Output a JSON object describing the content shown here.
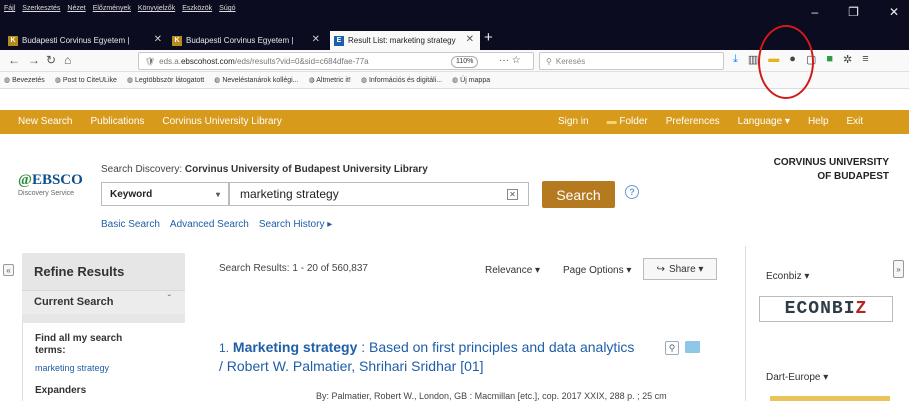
{
  "menubar": {
    "items": [
      "Fájl",
      "Szerkesztés",
      "Nézet",
      "Előzmények",
      "Könyvjelzők",
      "Eszközök",
      "Súgó"
    ]
  },
  "tabs": [
    {
      "title": "Budapesti Corvinus Egyetem |",
      "active": false
    },
    {
      "title": "Budapesti Corvinus Egyetem |",
      "active": false
    },
    {
      "title": "Result List: marketing strategy",
      "active": true
    }
  ],
  "urlbar": {
    "prefix": "eds.a.",
    "domain": "ebscohost.com",
    "path": "/eds/results?vid=0&sid=c684dfae-77a",
    "zoom": "110%",
    "search_placeholder": "Keresés"
  },
  "bookmarks": [
    "Bevezetés",
    "Post to CiteULike",
    "Legtöbbször látogatott",
    "Neveléstanárok kollégi...",
    "Altmetric it!",
    "Információs és digitáli...",
    "Új mappa"
  ],
  "ebsco_toolbar": {
    "left": [
      "New Search",
      "Publications",
      "Corvinus University Library"
    ],
    "right": [
      "Sign in",
      "Folder",
      "Preferences",
      "Language ▾",
      "Help",
      "Exit"
    ]
  },
  "logo": {
    "brand": "EBSCO",
    "sub": "Discovery Service"
  },
  "search": {
    "discovery_prefix": "Search Discovery:",
    "discovery_name": "Corvinus University of Budapest University Library",
    "field": "Keyword",
    "query": "marketing strategy",
    "button": "Search",
    "links": [
      "Basic Search",
      "Advanced Search",
      "Search History ▸"
    ]
  },
  "university": {
    "line1": "CORVINUS UNIVERSITY",
    "line2": "OF BUDAPEST"
  },
  "left_panel": {
    "refine_title": "Refine Results",
    "current_search": "Current Search",
    "find_all": "Find all my search terms:",
    "term": "marketing strategy",
    "expanders": "Expanders"
  },
  "results": {
    "count_text": "Search Results: 1 - 20 of 560,837",
    "relevance": "Relevance ▾",
    "page_options": "Page Options ▾",
    "share": "Share ▾",
    "items": [
      {
        "num": "1.",
        "title_bold": "Marketing strategy",
        "title_rest": ": Based on first principles and data analytics / Robert W. Palmatier, Shrihari Sridhar [01]",
        "byline": "By: Palmatier, Robert W., London, GB : Macmillan [etc.], cop. 2017 XXIX, 288 p. ; 25 cm"
      }
    ]
  },
  "right_panel": {
    "econbiz_label": "Econbiz ▾",
    "econbiz_logo_a": "ECON",
    "econbiz_logo_b": "BI",
    "econbiz_logo_c": "Z",
    "dart_label": "Dart-Europe ▾"
  },
  "colors": {
    "toolbar_orange": "#d89a1a",
    "search_button": "#b57a1f",
    "link_blue": "#1f5ea8",
    "annotation_red": "#d21a1a"
  }
}
